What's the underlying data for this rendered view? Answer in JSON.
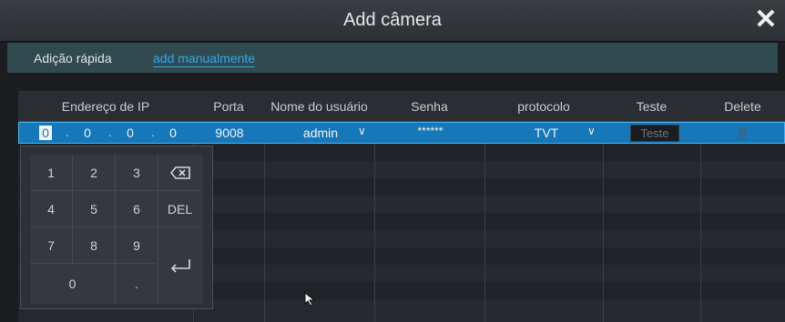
{
  "dialog": {
    "title": "Add câmera",
    "close_label": "✕"
  },
  "tabs": [
    {
      "label": "Adição rápida"
    },
    {
      "label": "add manualmente"
    }
  ],
  "table": {
    "headers": {
      "ip": "Endereço de IP",
      "port": "Porta",
      "user": "Nome do usuário",
      "password": "Senha",
      "protocol": "protocolo",
      "test": "Teste",
      "delete": "Delete"
    },
    "row": {
      "ip": [
        "0",
        "0",
        "0",
        "0"
      ],
      "ip_separator": ".",
      "port": "9008",
      "user": "admin",
      "password": "******",
      "protocol": "TVT",
      "test_button": "Teste"
    }
  },
  "keypad": {
    "keys": [
      "1",
      "2",
      "3",
      "4",
      "5",
      "6",
      "DEL",
      "7",
      "8",
      "9",
      "0",
      "."
    ],
    "backspace_icon": "backspace-icon",
    "enter_icon": "enter-icon"
  },
  "colors": {
    "selection": "#1678b8",
    "accent_link": "#2fa8e8",
    "tab_bar": "#314a50"
  }
}
